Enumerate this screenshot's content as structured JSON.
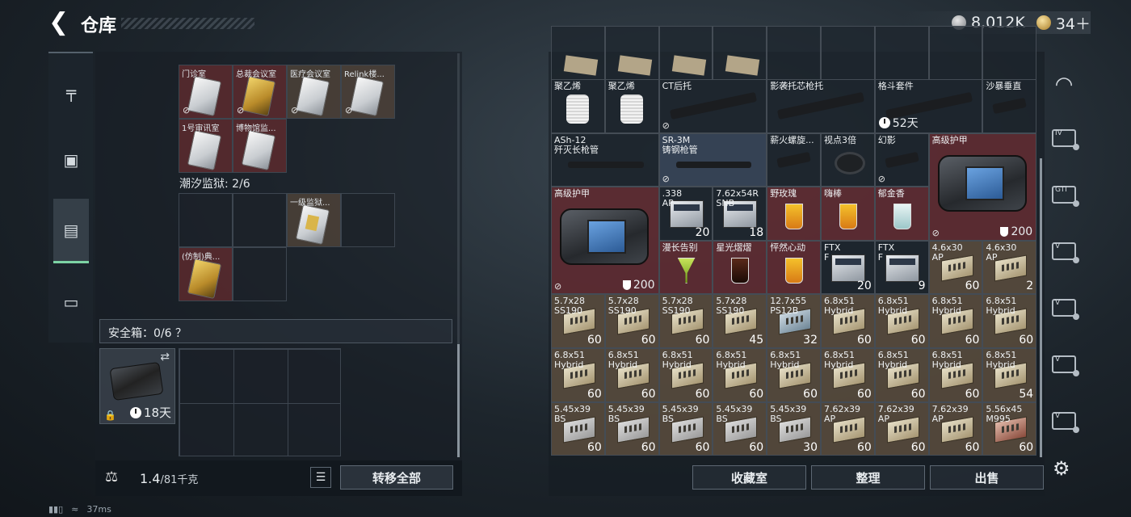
{
  "header": {
    "title": "仓库",
    "silver": "8,012K",
    "gold": "34＋"
  },
  "left_rail": [
    {
      "name": "weapon-icon",
      "glyph": "╤"
    },
    {
      "name": "backpack-icon",
      "glyph": "▣"
    },
    {
      "name": "container-icon",
      "glyph": "▤"
    },
    {
      "name": "toolbox-icon",
      "glyph": "▭"
    }
  ],
  "left_panel": {
    "keys_row1": [
      "门诊室",
      "总裁会议室",
      "医疗会议室",
      "Relink楼..."
    ],
    "keys_row2": [
      "1号审讯室",
      "博物馆监..."
    ],
    "prison_title": "潮汐监狱: 2/6",
    "prison_items": [
      "一级监狱...",
      "(仿制)典..."
    ],
    "safe_title": "安全箱：0/6 ？",
    "safe_timer": "18天"
  },
  "footer_left": {
    "weight": "1.4",
    "max": "/81千克",
    "transfer_all": "转移全部"
  },
  "grid_items": [
    {
      "label": "聚乙烯"
    },
    {
      "label": "聚乙烯"
    },
    {
      "label": "CT后托"
    },
    {
      "label": "影袭托芯枪托"
    },
    {
      "label": "格斗套件",
      "timer": "52天"
    },
    {
      "label": "沙暴垂直"
    },
    {
      "label": "ASh-12\n歼灭长枪管"
    },
    {
      "label": "SR-3M\n铸钢枪管"
    },
    {
      "label": "薪火螺旋..."
    },
    {
      "label": "视点3倍"
    },
    {
      "label": "幻影"
    },
    {
      "label": "高级护甲",
      "armor": "200"
    },
    {
      "label": "高级护甲",
      "armor": "200"
    },
    {
      "label": ".338\nAP",
      "qty": "20"
    },
    {
      "label": "7.62x54R\nSNB",
      "qty": "18"
    },
    {
      "label": "野玫瑰"
    },
    {
      "label": "嗨棒"
    },
    {
      "label": "郁金香"
    },
    {
      "label": "漫长告别"
    },
    {
      "label": "星光熠熠"
    },
    {
      "label": "怦然心动"
    },
    {
      "label": "FTX\nF",
      "qty": "20"
    },
    {
      "label": "FTX\nF",
      "qty": "9"
    },
    {
      "label": "4.6x30\nAP",
      "qty": "60"
    },
    {
      "label": "4.6x30\nAP",
      "qty": "2"
    },
    {
      "label": "5.7x28\nSS190",
      "qty": "60"
    },
    {
      "label": "5.7x28\nSS190",
      "qty": "60"
    },
    {
      "label": "5.7x28\nSS190",
      "qty": "60"
    },
    {
      "label": "5.7x28\nSS190",
      "qty": "45"
    },
    {
      "label": "12.7x55\nPS12B",
      "qty": "32"
    },
    {
      "label": "6.8x51\nHybrid",
      "qty": "60"
    },
    {
      "label": "6.8x51\nHybrid",
      "qty": "60"
    },
    {
      "label": "6.8x51\nHybrid",
      "qty": "60"
    },
    {
      "label": "6.8x51\nHybrid",
      "qty": "60"
    },
    {
      "label": "6.8x51\nHybrid",
      "qty": "60"
    },
    {
      "label": "6.8x51\nHybrid",
      "qty": "60"
    },
    {
      "label": "6.8x51\nHybrid",
      "qty": "60"
    },
    {
      "label": "6.8x51\nHybrid",
      "qty": "60"
    },
    {
      "label": "6.8x51\nHybrid",
      "qty": "60"
    },
    {
      "label": "6.8x51\nHybrid",
      "qty": "60"
    },
    {
      "label": "6.8x51\nHybrid",
      "qty": "60"
    },
    {
      "label": "6.8x51\nHybrid",
      "qty": "60"
    },
    {
      "label": "6.8x51\nHybrid",
      "qty": "54"
    },
    {
      "label": "5.45x39\nBS",
      "qty": "60"
    },
    {
      "label": "5.45x39\nBS",
      "qty": "60"
    },
    {
      "label": "5.45x39\nBS",
      "qty": "60"
    },
    {
      "label": "5.45x39\nBS",
      "qty": "60"
    },
    {
      "label": "5.45x39\nBS",
      "qty": "30"
    },
    {
      "label": "7.62x39\nAP",
      "qty": "60"
    },
    {
      "label": "7.62x39\nAP",
      "qty": "60"
    },
    {
      "label": "7.62x39\nAP",
      "qty": "60"
    },
    {
      "label": "5.56x45\nM995",
      "qty": "60"
    }
  ],
  "right_rail": [
    "IV",
    "GTI",
    "V",
    "V",
    "V",
    "V"
  ],
  "footer_right": {
    "collection": "收藏室",
    "sort": "整理",
    "sell": "出售"
  },
  "status": {
    "ping": "37ms"
  }
}
